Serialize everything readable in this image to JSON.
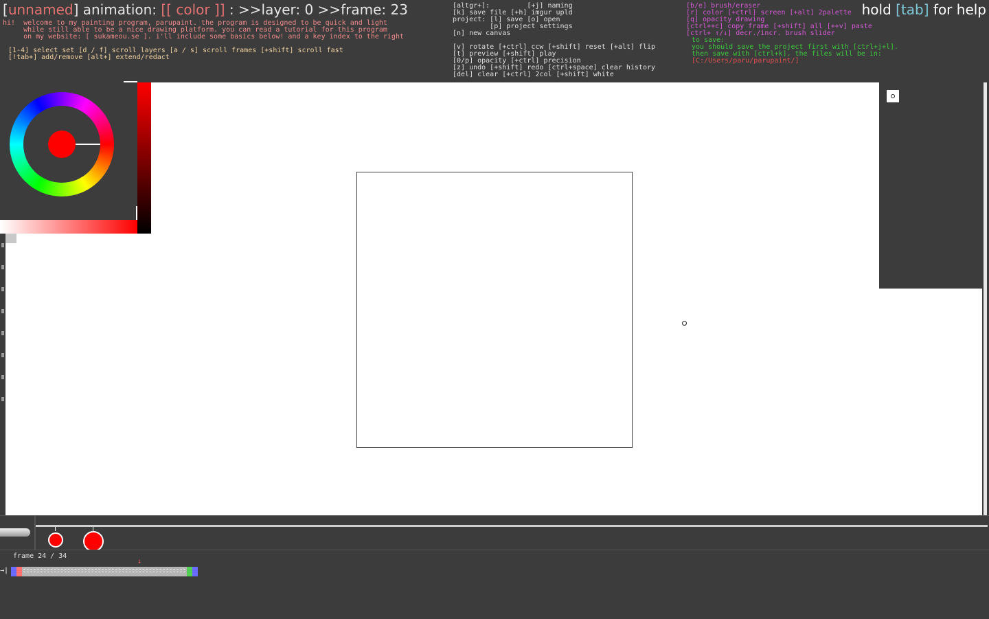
{
  "header": {
    "project_name": "unnamed",
    "mode_label": "animation:",
    "color_mode": "[[ color ]]",
    "layer_label": ">>layer: 0",
    "frame_label": ">>frame: 23",
    "intro_text": "hi!  welcome to my painting program, parupaint. the program is designed to be quick and light\n     while still able to be a nice drawing platform. you can read a tutorial for this program\n     on my website: [ sukameou.se ]. i'll include some basics below! and a key index to the right",
    "keys_left": "[1-4] select set [d / f] scroll layers [a / s] scroll frames [+shift] scroll fast\n[!tab+] add/remove [alt+] extend/redact",
    "keys_mid": "[altgr+]:         [+j] naming\n[k] save file [+h] imgur upld\nproject: [l] save [o] open\n         [p] project settings\n[n] new canvas\n\n[v] rotate [+ctrl] ccw [+shift] reset [+alt] flip\n[t] preview [+shift] play\n[0/p] opacity [+ctrl] precision\n[z] undo [+shift] redo [ctrl+space] clear history\n[del] clear [+ctrl] 2col [+shift] white",
    "keys_right": "[b/e] brush/eraser\n[r] color [+ctrl] screen [+alt] 2palette\n[q] opacity drawing\n[ctrl++c] copy frame [+shift] all [++v] paste\n[ctrl+ ↑/↓] decr./incr. brush slider",
    "save_hint": "to save:\nyou should save the project first with [ctrl+j+l].\nthen save with [ctrl+k]. the files will be in:",
    "save_path": "[C:/Users/paru/parupaint/]",
    "help_prefix": "hold ",
    "help_key": "[tab]",
    "help_suffix": " for help"
  },
  "color": {
    "current": "#ff0000",
    "ring": "hue-wheel"
  },
  "timeline": {
    "frame_text": "frame 24 / 34",
    "pointer": "→|",
    "marker": "↓"
  },
  "layers": {
    "thumbnail_icon": "layer-thumbnail"
  }
}
